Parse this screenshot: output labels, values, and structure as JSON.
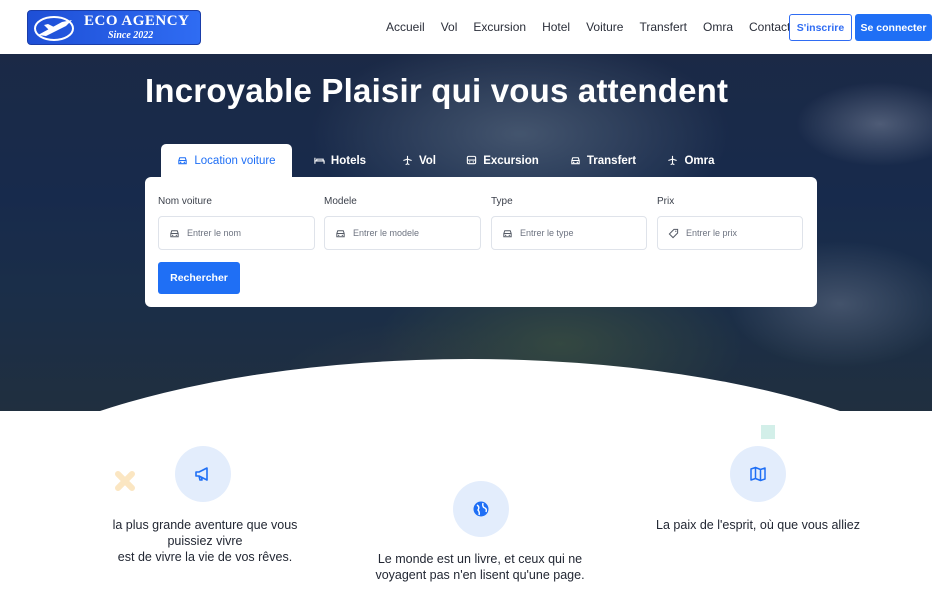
{
  "brand": {
    "name": "ECO AGENCY",
    "tagline": "Since 2022",
    "primary_color": "#1f6ff5"
  },
  "nav": {
    "links": [
      "Accueil",
      "Vol",
      "Excursion",
      "Hotel",
      "Voiture",
      "Transfert",
      "Omra",
      "Contact"
    ],
    "signup_label": "S'inscrire",
    "login_label": "Se connecter"
  },
  "hero": {
    "title": "Incroyable Plaisir qui vous attendent"
  },
  "search": {
    "tabs": [
      {
        "label": "Location voiture",
        "icon": "car-icon",
        "active": true
      },
      {
        "label": "Hotels",
        "icon": "bed-icon",
        "active": false
      },
      {
        "label": "Vol",
        "icon": "plane-icon",
        "active": false
      },
      {
        "label": "Excursion",
        "icon": "bus-icon",
        "active": false
      },
      {
        "label": "Transfert",
        "icon": "car-icon",
        "active": false
      },
      {
        "label": "Omra",
        "icon": "plane-icon",
        "active": false
      }
    ],
    "fields": [
      {
        "label": "Nom voiture",
        "placeholder": "Entrer le nom",
        "value": "",
        "icon": "car-icon"
      },
      {
        "label": "Modele",
        "placeholder": "Entrer le modele",
        "value": "",
        "icon": "car-icon"
      },
      {
        "label": "Type",
        "placeholder": "Entrer le type",
        "value": "",
        "icon": "car-icon"
      },
      {
        "label": "Prix",
        "placeholder": "Entrer le prix",
        "value": "",
        "icon": "tag-icon"
      }
    ],
    "submit_label": "Rechercher"
  },
  "features": [
    {
      "icon": "megaphone-icon",
      "text_lines": [
        "la plus grande aventure que vous",
        "puissiez vivre",
        "est de vivre la vie de vos rêves."
      ]
    },
    {
      "icon": "globe-icon",
      "text_lines": [
        "Le monde est un livre, et ceux qui ne",
        "voyagent pas n'en lisent qu'une page."
      ]
    },
    {
      "icon": "map-icon",
      "text_lines": [
        "La paix de l'esprit, où que vous alliez"
      ]
    }
  ]
}
